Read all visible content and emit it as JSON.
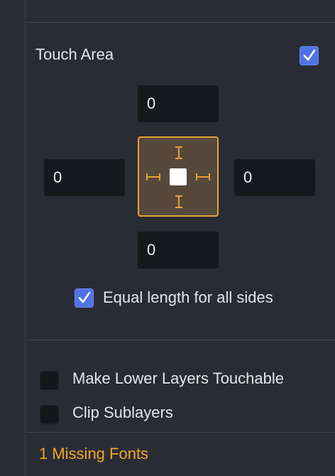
{
  "touch_area": {
    "title": "Touch Area",
    "enabled": true,
    "top": "0",
    "left": "0",
    "right": "0",
    "bottom": "0",
    "equal_length_label": "Equal length for all sides",
    "equal_length_checked": true
  },
  "options": {
    "lower_layers_label": "Make Lower Layers Touchable",
    "lower_layers_checked": false,
    "clip_label": "Clip Sublayers",
    "clip_checked": false
  },
  "footer": {
    "missing_fonts": "1 Missing Fonts"
  },
  "colors": {
    "accent_blue": "#4f73e6",
    "handle_orange": "#e4a136",
    "warning": "#f0a822"
  }
}
